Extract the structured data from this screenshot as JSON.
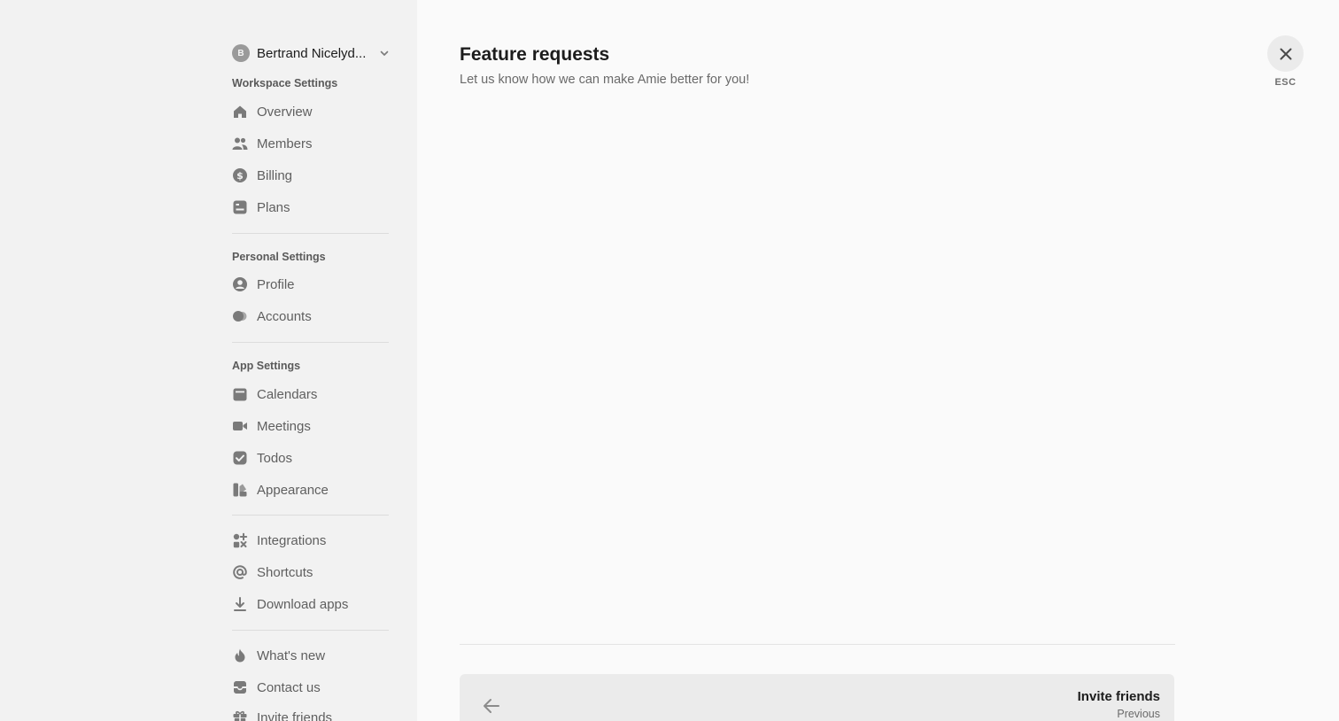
{
  "workspace": {
    "avatar_initial": "B",
    "name": "Bertrand Nicelyd..."
  },
  "sections": {
    "workspace": "Workspace Settings",
    "personal": "Personal Settings",
    "app": "App Settings"
  },
  "nav": {
    "overview": "Overview",
    "members": "Members",
    "billing": "Billing",
    "plans": "Plans",
    "profile": "Profile",
    "accounts": "Accounts",
    "calendars": "Calendars",
    "meetings": "Meetings",
    "todos": "Todos",
    "appearance": "Appearance",
    "integrations": "Integrations",
    "shortcuts": "Shortcuts",
    "download_apps": "Download apps",
    "whats_new": "What's new",
    "contact_us": "Contact us",
    "invite_friends": "Invite friends"
  },
  "main": {
    "title": "Feature requests",
    "subtitle": "Let us know how we can make Amie better for you!",
    "esc_label": "ESC",
    "prev_card": {
      "title": "Invite friends",
      "label": "Previous"
    }
  },
  "colors": {
    "sidebar_bg": "#f2f2f2",
    "main_bg": "#fafafa",
    "icon": "#7a7a7a",
    "card_bg": "#ebebeb"
  }
}
